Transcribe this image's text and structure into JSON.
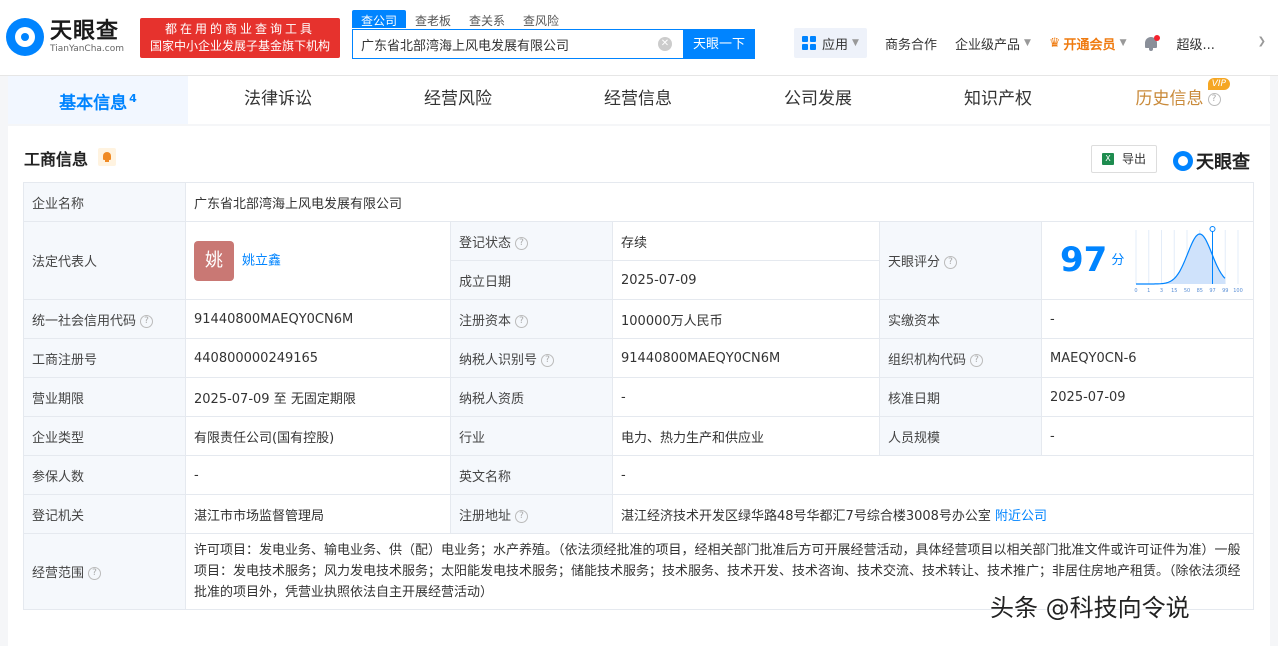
{
  "header": {
    "logo_cn": "天眼查",
    "logo_en": "TianYanCha.com",
    "slogan_line1": "都在用的商业查询工具",
    "slogan_line2": "国家中小企业发展子基金旗下机构",
    "search_tabs": [
      "查公司",
      "查老板",
      "查关系",
      "查风险"
    ],
    "search_value": "广东省北部湾海上风电发展有限公司",
    "search_button": "天眼一下",
    "app_label": "应用",
    "business": "商务合作",
    "enterprise": "企业级产品",
    "vip": "开通会员",
    "user": "超级..."
  },
  "tabs": [
    {
      "label": "基本信息",
      "count": "4"
    },
    {
      "label": "法律诉讼"
    },
    {
      "label": "经营风险"
    },
    {
      "label": "经营信息"
    },
    {
      "label": "公司发展"
    },
    {
      "label": "知识产权"
    },
    {
      "label": "历史信息",
      "badge": "VIP"
    }
  ],
  "panel": {
    "title": "工商信息",
    "export": "导出",
    "brand": "天眼查"
  },
  "info": {
    "company_name_label": "企业名称",
    "company_name": "广东省北部湾海上风电发展有限公司",
    "legal_rep_label": "法定代表人",
    "legal_rep_avatar": "姚",
    "legal_rep": "姚立鑫",
    "status_label": "登记状态",
    "status": "存续",
    "established_label": "成立日期",
    "established": "2025-07-09",
    "score_label": "天眼评分",
    "score": "97",
    "score_unit": "分",
    "credit_code_label": "统一社会信用代码",
    "credit_code": "91440800MAEQY0CN6M",
    "reg_capital_label": "注册资本",
    "reg_capital": "100000万人民币",
    "paid_capital_label": "实缴资本",
    "paid_capital": "-",
    "reg_no_label": "工商注册号",
    "reg_no": "440800000249165",
    "taxpayer_id_label": "纳税人识别号",
    "taxpayer_id": "91440800MAEQY0CN6M",
    "org_code_label": "组织机构代码",
    "org_code": "MAEQY0CN-6",
    "term_label": "营业期限",
    "term": "2025-07-09 至 无固定期限",
    "taxpayer_qual_label": "纳税人资质",
    "taxpayer_qual": "-",
    "approval_date_label": "核准日期",
    "approval_date": "2025-07-09",
    "company_type_label": "企业类型",
    "company_type": "有限责任公司(国有控股)",
    "industry_label": "行业",
    "industry": "电力、热力生产和供应业",
    "staff_size_label": "人员规模",
    "staff_size": "-",
    "insured_label": "参保人数",
    "insured": "-",
    "english_name_label": "英文名称",
    "english_name": "-",
    "authority_label": "登记机关",
    "authority": "湛江市市场监督管理局",
    "address_label": "注册地址",
    "address": "湛江经济技术开发区绿华路48号华都汇7号综合楼3008号办公室",
    "nearby": "附近公司",
    "scope_label": "经营范围",
    "scope": "许可项目：发电业务、输电业务、供（配）电业务；水产养殖。（依法须经批准的项目，经相关部门批准后方可开展经营活动，具体经营项目以相关部门批准文件或许可证件为准）一般项目：发电技术服务；风力发电技术服务；太阳能发电技术服务；储能技术服务；技术服务、技术开发、技术咨询、技术交流、技术转让、技术推广；非居住房地产租赁。（除依法须经批准的项目外，凭营业执照依法自主开展经营活动）"
  },
  "score_chart": {
    "ticks": [
      "0",
      "1",
      "3",
      "15",
      "50",
      "85",
      "97",
      "99",
      "100"
    ],
    "marker": 97
  },
  "watermark": "头条 @科技向令说",
  "colors": {
    "accent": "#0084ff",
    "status": "#2fae4c",
    "vip": "#ef7b10",
    "slogan_bg": "#e6322d"
  }
}
